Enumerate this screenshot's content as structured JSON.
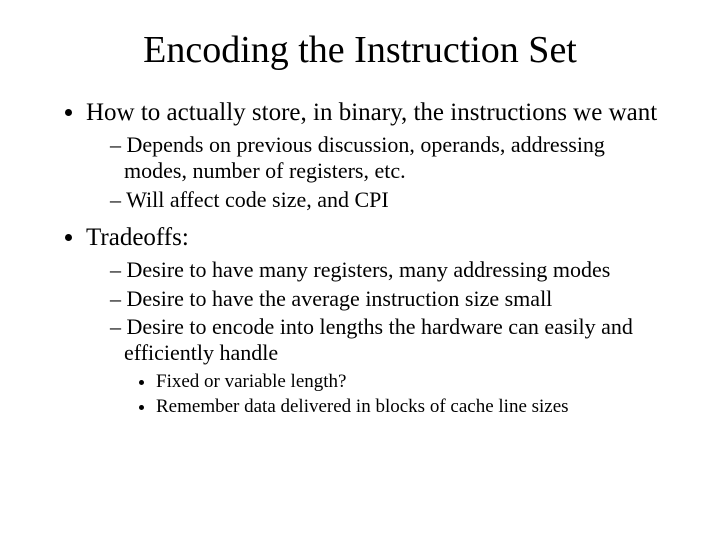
{
  "title": "Encoding the Instruction Set",
  "b1": "How to actually store, in binary, the instructions we want",
  "b1s1": "Depends on previous discussion, operands, addressing modes, number of registers, etc.",
  "b1s2": "Will affect code size, and CPI",
  "b2": "Tradeoffs:",
  "b2s1": "Desire to have many registers, many addressing modes",
  "b2s2": "Desire to have the average instruction size small",
  "b2s3": "Desire to encode into lengths the hardware can easily and efficiently handle",
  "b2s3a": "Fixed or variable length?",
  "b2s3b": "Remember data delivered in blocks of cache line sizes"
}
